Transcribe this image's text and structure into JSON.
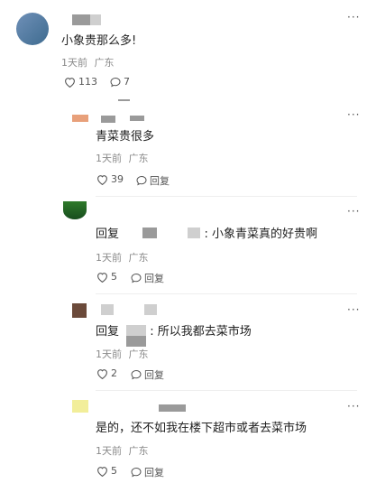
{
  "main_comment": {
    "text": "小象贵那么多!",
    "time": "1天前",
    "location": "广东",
    "likes": "113",
    "replies": "7"
  },
  "replies": [
    {
      "prefix": "",
      "text": "青菜贵很多",
      "time": "1天前",
      "location": "广东",
      "likes": "39",
      "reply_label": "回复"
    },
    {
      "prefix": "回复",
      "text": ": 小象青菜真的好贵啊",
      "time": "1天前",
      "location": "广东",
      "likes": "5",
      "reply_label": "回复"
    },
    {
      "prefix": "回复",
      "text": ": 所以我都去菜市场",
      "time": "1天前",
      "location": "广东",
      "likes": "2",
      "reply_label": "回复"
    },
    {
      "prefix": "",
      "text": "是的，还不如我在楼下超市或者去菜市场",
      "time": "1天前",
      "location": "广东",
      "likes": "5",
      "reply_label": "回复"
    }
  ],
  "more_icon": "more-dots-icon",
  "like_icon": "heart-icon",
  "reply_icon": "comment-bubble-icon"
}
